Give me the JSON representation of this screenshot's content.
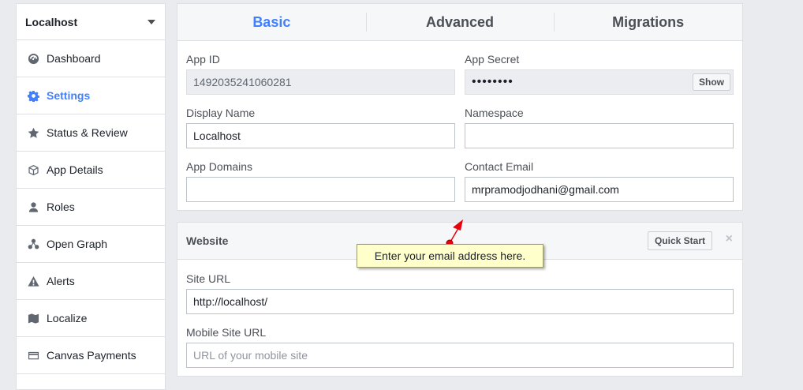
{
  "sidebar": {
    "app_name": "Localhost",
    "items": [
      {
        "label": "Dashboard"
      },
      {
        "label": "Settings"
      },
      {
        "label": "Status & Review"
      },
      {
        "label": "App Details"
      },
      {
        "label": "Roles"
      },
      {
        "label": "Open Graph"
      },
      {
        "label": "Alerts"
      },
      {
        "label": "Localize"
      },
      {
        "label": "Canvas Payments"
      }
    ]
  },
  "tabs": [
    {
      "label": "Basic"
    },
    {
      "label": "Advanced"
    },
    {
      "label": "Migrations"
    }
  ],
  "basic": {
    "app_id_label": "App ID",
    "app_id_value": "1492035241060281",
    "app_secret_label": "App Secret",
    "app_secret_value": "••••••••",
    "show_label": "Show",
    "display_name_label": "Display Name",
    "display_name_value": "Localhost",
    "namespace_label": "Namespace",
    "namespace_value": "",
    "app_domains_label": "App Domains",
    "app_domains_value": "",
    "contact_email_label": "Contact Email",
    "contact_email_value": "mrpramodjodhani@gmail.com"
  },
  "website": {
    "title": "Website",
    "quick_start_label": "Quick Start",
    "close_glyph": "×",
    "site_url_label": "Site URL",
    "site_url_value": "http://localhost/",
    "mobile_site_url_label": "Mobile Site URL",
    "mobile_site_url_placeholder": "URL of your mobile site"
  },
  "tooltip": {
    "text": "Enter your email address here."
  },
  "colors": {
    "accent": "#4080ff",
    "background": "#e9ebee",
    "tooltip_bg": "#ffffcc",
    "arrow": "#e8000b"
  },
  "icons": {
    "dashboard": "dashboard-gauge-icon",
    "settings": "gear-icon",
    "status_review": "star-icon",
    "app_details": "cube-icon",
    "roles": "person-icon",
    "open_graph": "graph-nodes-icon",
    "alerts": "warning-triangle-icon",
    "localize": "map-icon",
    "canvas_payments": "credit-card-icon",
    "dropdown": "caret-down-icon"
  }
}
